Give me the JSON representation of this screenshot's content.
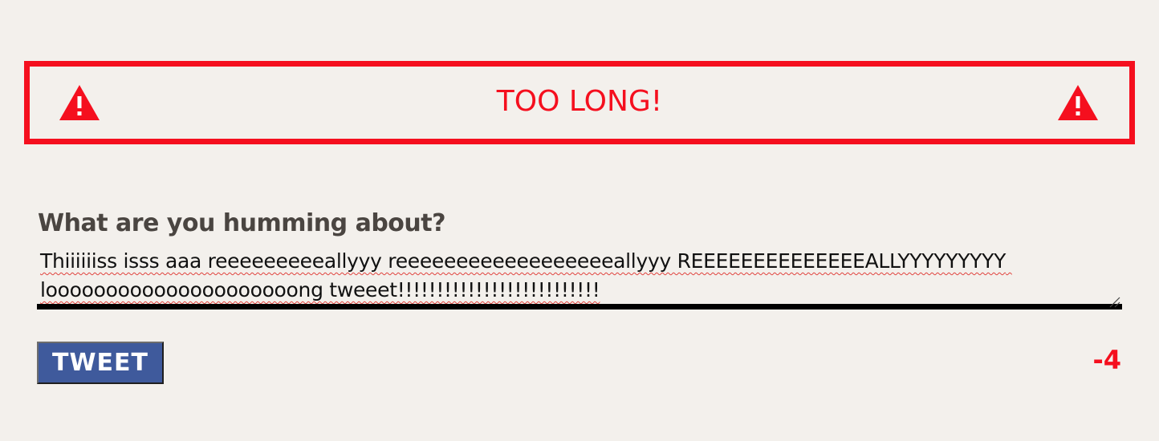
{
  "alert": {
    "message": "TOO LONG!",
    "icon_left": "warning-triangle-icon",
    "icon_right": "warning-triangle-icon",
    "color": "#f50f1e"
  },
  "compose": {
    "label": "What are you humming about?",
    "text": "Thiiiiiiss isss aaa reeeeeeeeeallyyy reeeeeeeeeeeeeeeeeeallyyy REEEEEEEEEEEEEEALLYYYYYYYYY looooooooooooooooooooong tweeet!!!!!!!!!!!!!!!!!!!!!!!!!!"
  },
  "actions": {
    "tweet_label": "TWEET",
    "char_count": "-4"
  },
  "colors": {
    "background": "#f3f0ec",
    "alert_red": "#f50f1e",
    "button_blue": "#3f5a9c",
    "label_text": "#4a4541"
  }
}
